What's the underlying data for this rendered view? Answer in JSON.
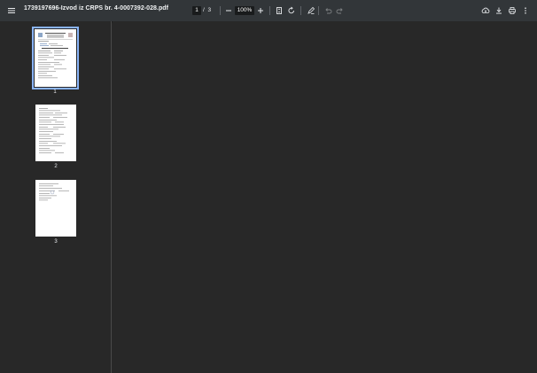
{
  "toolbar": {
    "menu_icon": "hamburger-menu-icon",
    "title": "1739197696-Izvod iz CRPS br. 4-0007392-028.pdf",
    "current_page": "1",
    "page_separator": "/",
    "total_pages": "3",
    "zoom_out_icon": "minus-icon",
    "zoom_value": "100%",
    "zoom_in_icon": "plus-icon",
    "fit_icon": "fit-to-page-icon",
    "rotate_icon": "rotate-icon",
    "annotate_icon": "draw-annotation-icon",
    "undo_icon": "undo-icon",
    "redo_icon": "redo-icon",
    "download_cloud_icon": "save-to-drive-icon",
    "download_icon": "download-icon",
    "print_icon": "print-icon",
    "more_icon": "more-vertical-icon"
  },
  "sidebar": {
    "thumbnails": [
      {
        "label": "1",
        "selected": true
      },
      {
        "label": "2",
        "selected": false
      },
      {
        "label": "3",
        "selected": false
      }
    ]
  },
  "colors": {
    "toolbar_bg": "#323639",
    "viewer_bg": "#282828",
    "selection": "#8ab4f8"
  }
}
